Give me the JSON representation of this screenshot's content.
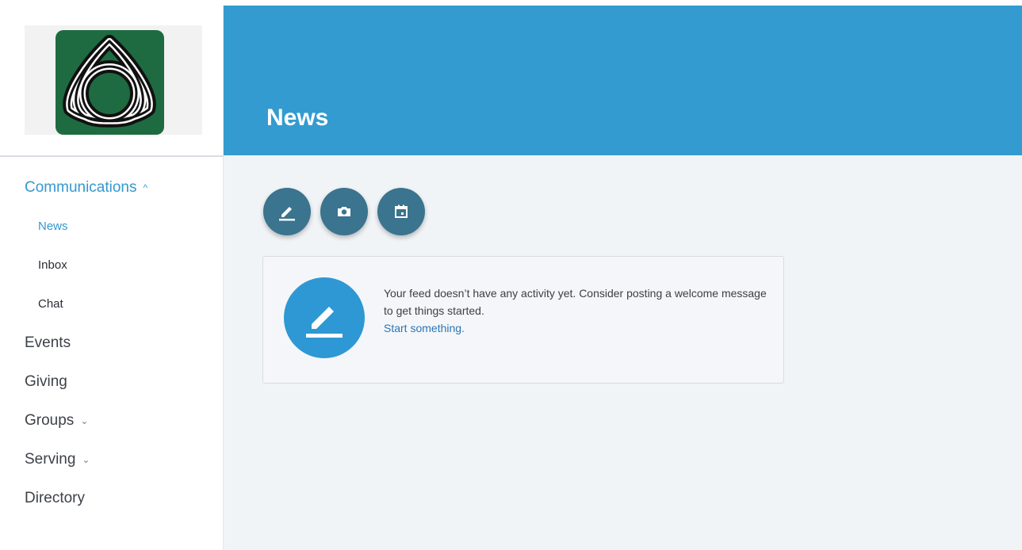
{
  "sidebar": {
    "nav": [
      {
        "label": "Communications",
        "chevron": "^",
        "expanded": true,
        "children": [
          {
            "label": "News",
            "active": true
          },
          {
            "label": "Inbox"
          },
          {
            "label": "Chat"
          }
        ]
      },
      {
        "label": "Events"
      },
      {
        "label": "Giving"
      },
      {
        "label": "Groups",
        "chevron": "v"
      },
      {
        "label": "Serving",
        "chevron": "v"
      },
      {
        "label": "Directory"
      }
    ]
  },
  "header": {
    "title": "News"
  },
  "actions": [
    {
      "icon": "edit-icon"
    },
    {
      "icon": "camera-icon"
    },
    {
      "icon": "calendar-icon"
    }
  ],
  "feed": {
    "empty_message": "Your feed doesn’t have any activity yet. Consider posting a welcome message to get things started.",
    "cta_link": "Start something."
  },
  "colors": {
    "header": "#339bd0",
    "accent": "#3498d0",
    "action_button": "#3a748f",
    "logo_bg": "#1e6b41"
  }
}
